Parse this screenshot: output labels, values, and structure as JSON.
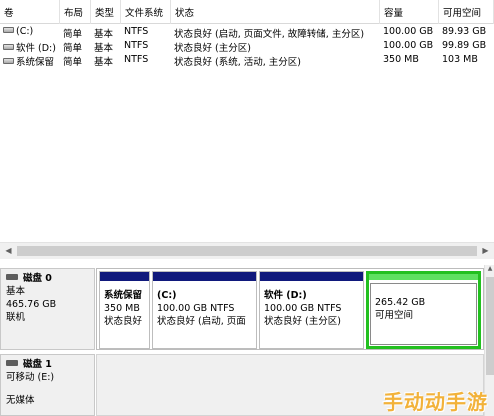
{
  "volume_table": {
    "columns": [
      "卷",
      "布局",
      "类型",
      "文件系统",
      "状态",
      "容量",
      "可用空间"
    ],
    "rows": [
      {
        "volume": "(C:)",
        "layout": "简单",
        "type": "基本",
        "fs": "NTFS",
        "status": "状态良好 (启动, 页面文件, 故障转储, 主分区)",
        "capacity": "100.00 GB",
        "free": "89.93 GB"
      },
      {
        "volume": "软件 (D:)",
        "layout": "简单",
        "type": "基本",
        "fs": "NTFS",
        "status": "状态良好 (主分区)",
        "capacity": "100.00 GB",
        "free": "99.89 GB"
      },
      {
        "volume": "系统保留",
        "layout": "简单",
        "type": "基本",
        "fs": "NTFS",
        "status": "状态良好 (系统, 活动, 主分区)",
        "capacity": "350 MB",
        "free": "103 MB"
      }
    ]
  },
  "scrollbar": {
    "left_arrow": "◀",
    "right_arrow": "▶",
    "up_arrow": "▲"
  },
  "disk0": {
    "name": "磁盘 0",
    "type": "基本",
    "size": "465.76 GB",
    "state": "联机",
    "partitions": [
      {
        "title": "系统保留",
        "size": "350 MB",
        "status": "状态良好"
      },
      {
        "title": "(C:)",
        "size": "100.00 GB NTFS",
        "status": "状态良好 (启动, 页面"
      },
      {
        "title": "软件 (D:)",
        "size": "100.00 GB NTFS",
        "status": "状态良好 (主分区)"
      },
      {
        "title": "",
        "size": "265.42 GB",
        "status": "可用空间"
      }
    ]
  },
  "disk1": {
    "name": "磁盘 1",
    "type": "可移动 (E:)",
    "state": "无媒体"
  },
  "watermark": "手动动手游",
  "colors": {
    "primary_partition_bar": "#10197c",
    "free_space_bar": "#5ee060",
    "free_space_border": "#22c01f",
    "watermark": "#f2b23a"
  }
}
